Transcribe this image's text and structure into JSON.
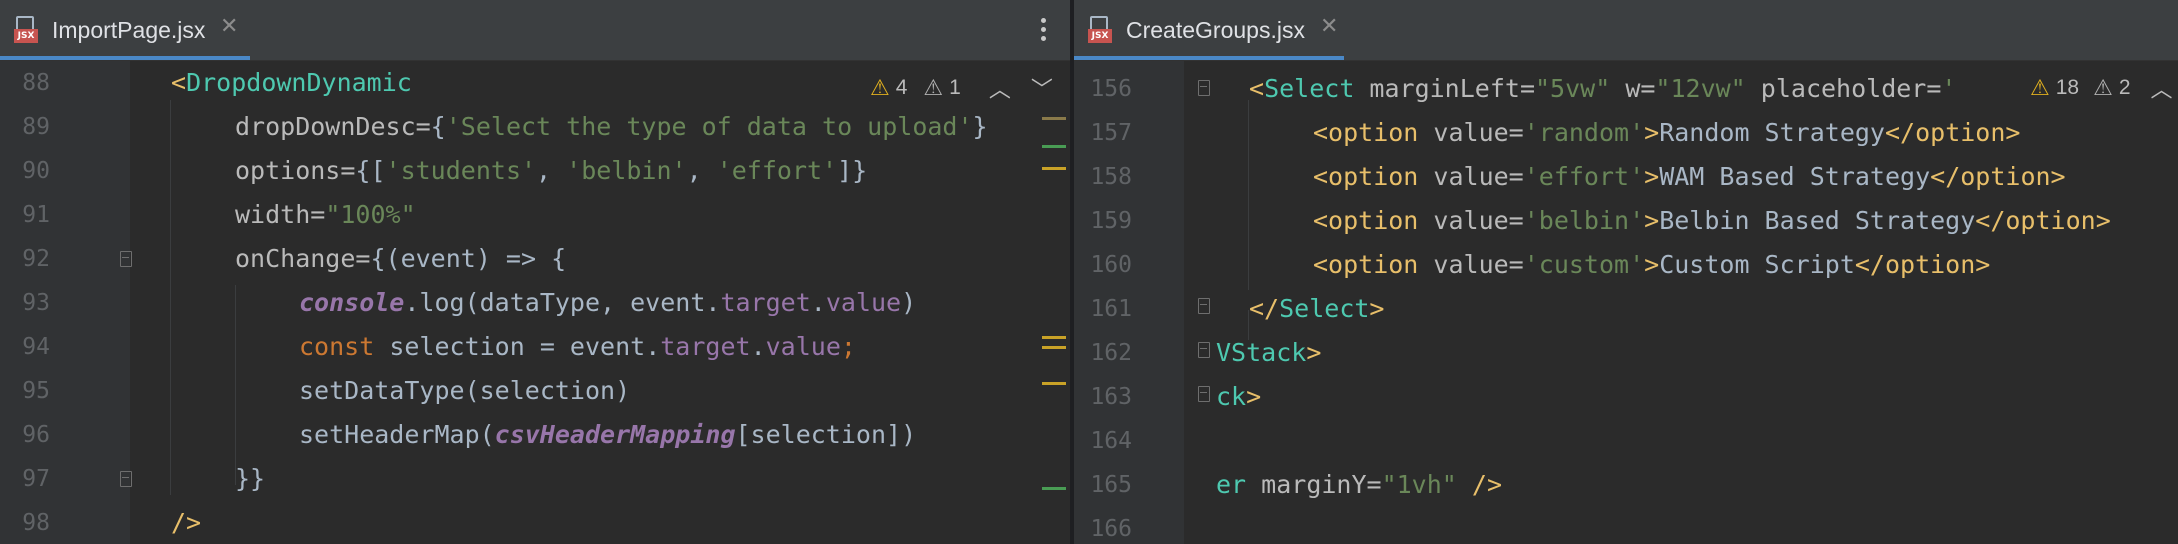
{
  "left": {
    "tab": {
      "title": "ImportPage.jsx",
      "close": "✕",
      "icon_label": "JSX"
    },
    "inspections": {
      "warnings": "4",
      "weak_warnings": "1"
    },
    "line_numbers": [
      "88",
      "89",
      "90",
      "91",
      "92",
      "93",
      "94",
      "95",
      "96",
      "97",
      "98"
    ],
    "code": {
      "l88": {
        "a": "<",
        "b": "DropdownDynamic"
      },
      "l89": {
        "a": "dropDownDesc=",
        "b": "{",
        "c": "'Select the type of data to upload'",
        "d": "}"
      },
      "l90": {
        "a": "options=",
        "b": "{[",
        "c": "'students'",
        "d": ", ",
        "e": "'belbin'",
        "f": ", ",
        "g": "'effort'",
        "h": "]}"
      },
      "l91": {
        "a": "width=",
        "b": "\"100%\""
      },
      "l92": {
        "a": "onChange=",
        "b": "{(event) => {"
      },
      "l93": {
        "a": "console",
        "b": ".log(dataType, event.",
        "c": "target",
        "d": ".",
        "e": "value",
        "f": ")"
      },
      "l94": {
        "a": "const",
        "b": " selection = event.",
        "c": "target",
        "d": ".",
        "e": "value",
        "f": ";"
      },
      "l95": {
        "a": "setDataType(selection)"
      },
      "l96": {
        "a": "setHeaderMap(",
        "b": "csvHeaderMapping",
        "c": "[selection])"
      },
      "l97": {
        "a": "}}"
      },
      "l98": {
        "a": "/>"
      }
    }
  },
  "right": {
    "tab": {
      "title": "CreateGroups.jsx",
      "close": "✕",
      "icon_label": "JSX"
    },
    "inspections": {
      "warnings": "18",
      "weak_warnings": "2"
    },
    "line_numbers": [
      "156",
      "157",
      "158",
      "159",
      "160",
      "161",
      "162",
      "163",
      "164",
      "165",
      "166"
    ],
    "code": {
      "l156": {
        "a": "<",
        "b": "Select",
        "c": " marginLeft=",
        "d": "\"5vw\"",
        "e": " w=",
        "f": "\"12vw\"",
        "g": " placeholder=",
        "h": "'"
      },
      "l157": {
        "a": "<option",
        "b": " value=",
        "c": "'random'",
        "d": ">",
        "e": "Random Strategy",
        "f": "</option>"
      },
      "l158": {
        "a": "<option",
        "b": " value=",
        "c": "'effort'",
        "d": ">",
        "e": "WAM Based Strategy",
        "f": "</option>"
      },
      "l159": {
        "a": "<option",
        "b": " value=",
        "c": "'belbin'",
        "d": ">",
        "e": "Belbin Based Strategy",
        "f": "</option>"
      },
      "l160": {
        "a": "<option",
        "b": " value=",
        "c": "'custom'",
        "d": ">",
        "e": "Custom Script",
        "f": "</option>"
      },
      "l161": {
        "a": "</",
        "b": "Select",
        "c": ">"
      },
      "l162": {
        "a": "VStack",
        "b": ">"
      },
      "l163": {
        "a": "ck",
        "b": ">"
      },
      "l164": {
        "a": ""
      },
      "l165": {
        "a": "er",
        "b": " marginY=",
        "c": "\"1vh\"",
        "d": " />"
      },
      "l166": {
        "a": ""
      }
    }
  },
  "colors": {
    "warning": "#e0b020",
    "added": "#499c54",
    "modified": "#c9a227",
    "tab_underline": "#4a88c7"
  },
  "icons": {
    "warning": "warning-triangle-icon",
    "weak": "weak-warning-icon",
    "up": "chevron-up-icon",
    "down": "chevron-down-icon",
    "more": "more-vertical-icon"
  }
}
